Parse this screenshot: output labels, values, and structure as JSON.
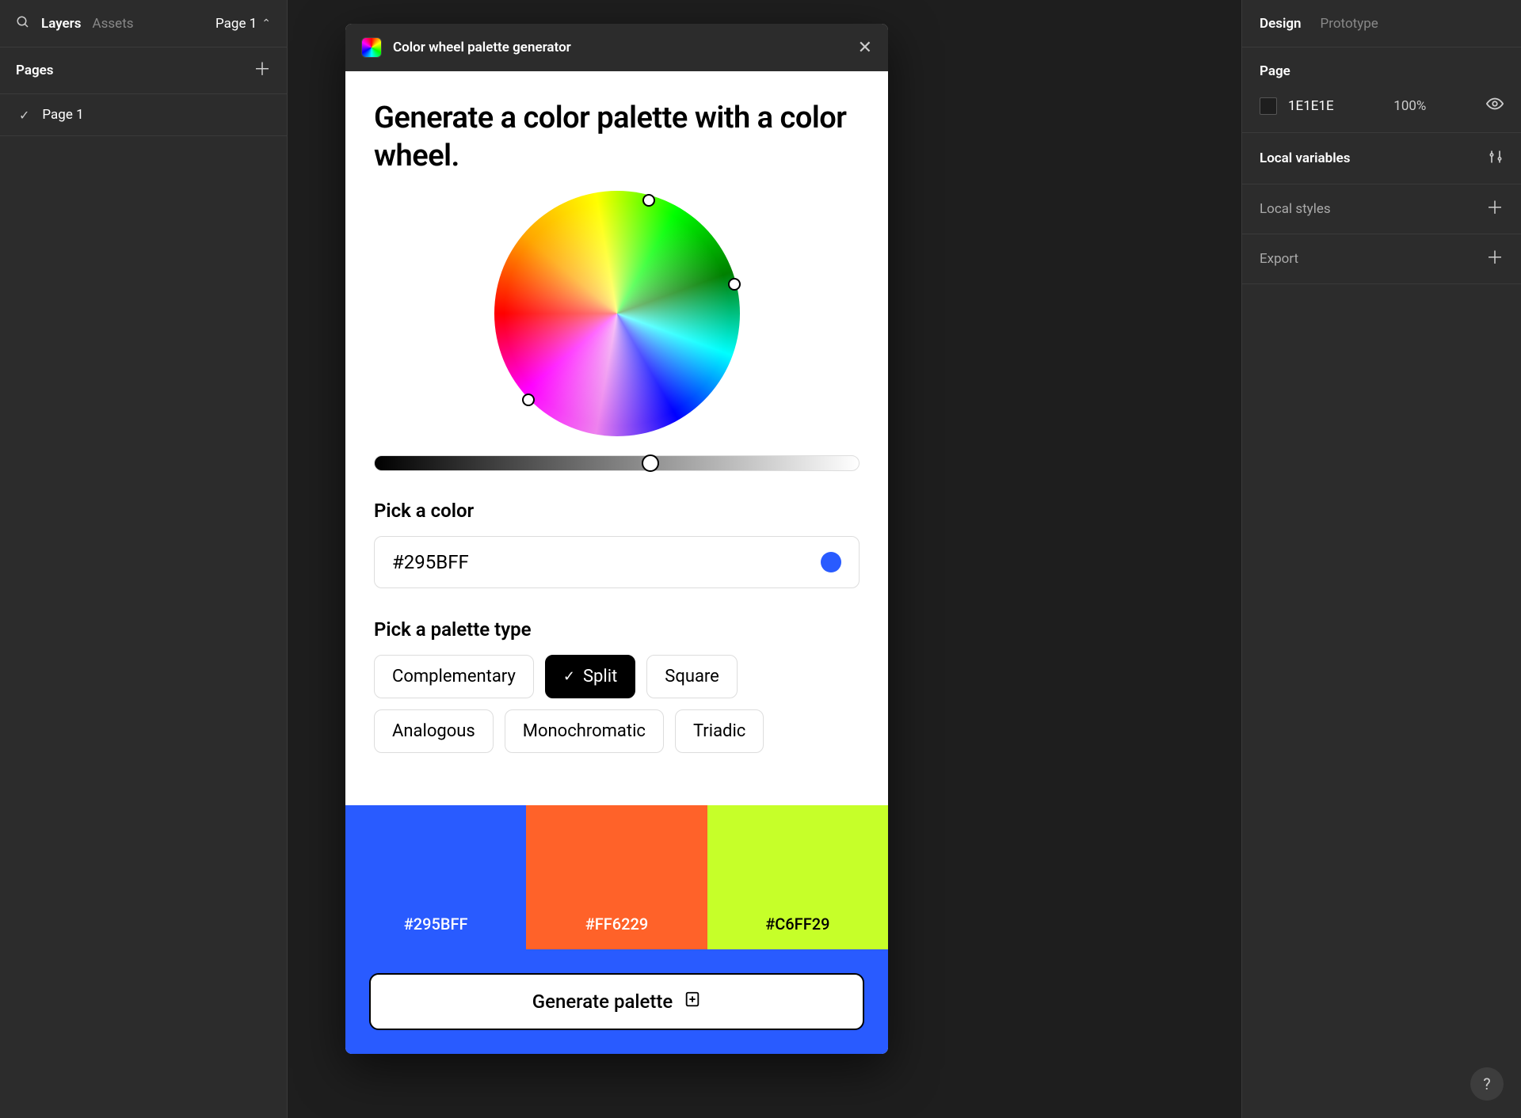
{
  "left_panel": {
    "tabs": {
      "layers": "Layers",
      "assets": "Assets"
    },
    "page_selector": "Page 1",
    "pages_header": "Pages",
    "page_items": [
      "Page 1"
    ]
  },
  "right_panel": {
    "tabs": {
      "design": "Design",
      "prototype": "Prototype"
    },
    "page_section": {
      "label": "Page",
      "color_hex": "1E1E1E",
      "opacity": "100%"
    },
    "local_variables": "Local variables",
    "local_styles": "Local styles",
    "export": "Export"
  },
  "plugin": {
    "title": "Color wheel palette generator",
    "heading": "Generate a color palette with a color wheel.",
    "pick_color_label": "Pick a color",
    "picked_color": "#295BFF",
    "picked_color_dot": "#295BFF",
    "pick_palette_label": "Pick a palette type",
    "palette_types": [
      {
        "label": "Complementary",
        "active": false
      },
      {
        "label": "Split",
        "active": true
      },
      {
        "label": "Square",
        "active": false
      },
      {
        "label": "Analogous",
        "active": false
      },
      {
        "label": "Monochromatic",
        "active": false
      },
      {
        "label": "Triadic",
        "active": false
      }
    ],
    "swatches": [
      {
        "hex": "#295BFF",
        "text_dark": false
      },
      {
        "hex": "#FF6229",
        "text_dark": false
      },
      {
        "hex": "#C6FF29",
        "text_dark": true
      }
    ],
    "generate_label": "Generate palette",
    "footer_bg": "#295BFF"
  },
  "help": "?"
}
